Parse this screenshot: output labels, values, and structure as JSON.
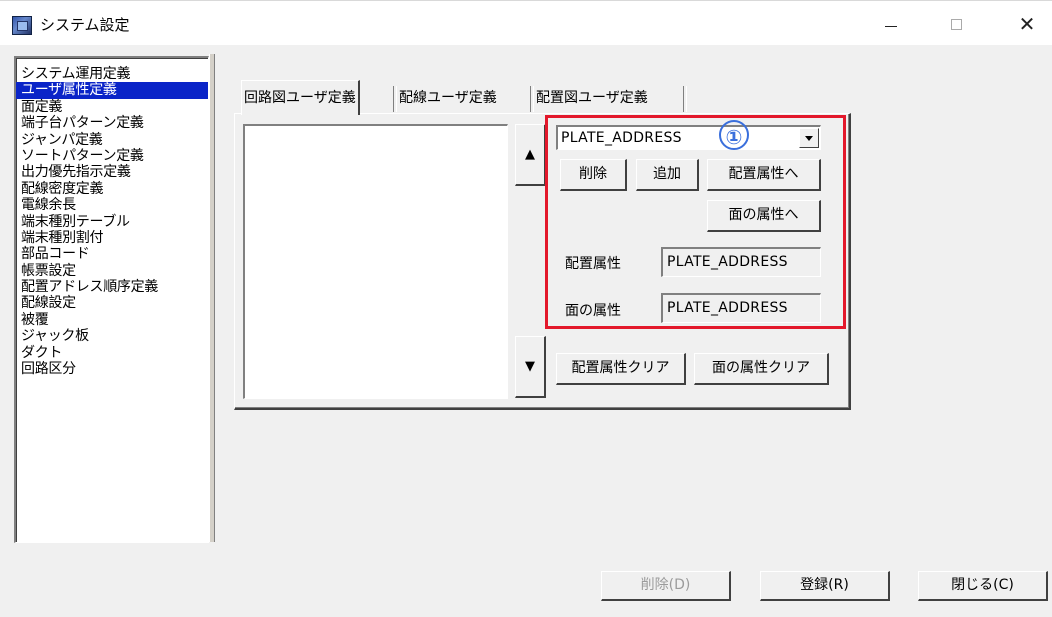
{
  "window": {
    "title": "システム設定"
  },
  "sidebar": {
    "items": [
      "システム運用定義",
      "ユーザ属性定義",
      "面定義",
      "端子台パターン定義",
      "ジャンパ定義",
      "ソートパターン定義",
      "出力優先指示定義",
      "配線密度定義",
      "電線余長",
      "端末種別テーブル",
      "端末種別割付",
      "部品コード",
      "帳票設定",
      "配置アドレス順序定義",
      "配線設定",
      "被覆",
      "ジャック板",
      "ダクト",
      "回路区分"
    ],
    "selected_index": 1
  },
  "tabs": [
    "回路図ユーザ定義",
    "配線ユーザ定義",
    "配置図ユーザ定義"
  ],
  "active_tab": 0,
  "panel": {
    "up_arrow": "▲",
    "down_arrow": "▼",
    "combo_value": "PLATE_ADDRESS",
    "annotation_badge": "①",
    "delete_button": "削除",
    "add_button": "追加",
    "to_placement_button": "配置属性へ",
    "to_surface_button": "面の属性へ",
    "placement_label": "配置属性",
    "placement_value": "PLATE_ADDRESS",
    "surface_label": "面の属性",
    "surface_value": "PLATE_ADDRESS",
    "clear_placement_button": "配置属性クリア",
    "clear_surface_button": "面の属性クリア"
  },
  "footer": {
    "delete_button": "削除(D)",
    "register_button": "登録(R)",
    "close_button": "閉じる(C)"
  },
  "colors": {
    "selection": "#0a24c8",
    "highlight_box": "#e3182b",
    "badge": "#3a6fdc"
  }
}
